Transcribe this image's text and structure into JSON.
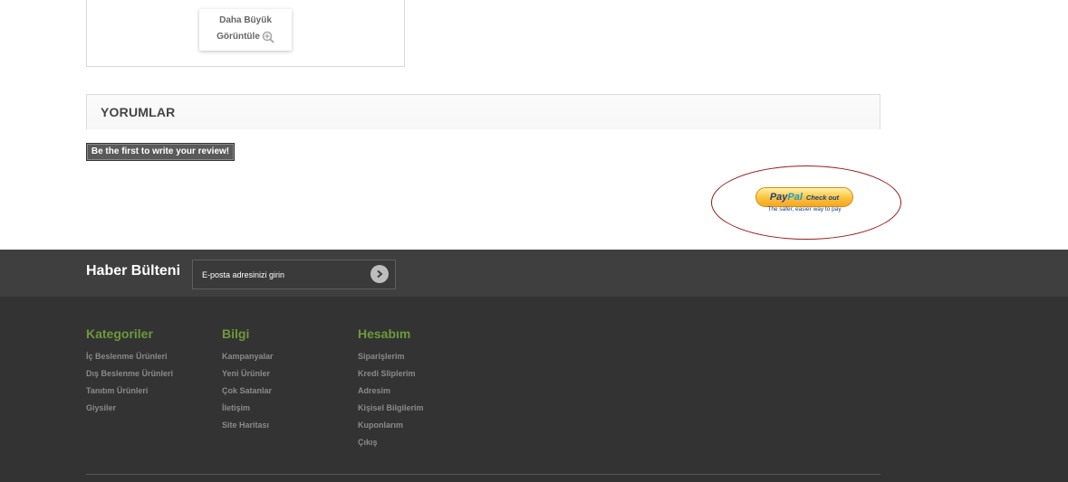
{
  "product_image": {
    "zoom_line1": "Daha Büyük",
    "zoom_line2": "Görüntüle",
    "zoom_icon": "magnifier-plus-icon"
  },
  "comments": {
    "title": "YORUMLAR",
    "review_button": "Be the first to write your review!"
  },
  "paypal": {
    "logo_pay": "Pay",
    "logo_pal": "Pal",
    "checkout": "Check out",
    "tagline": "The safer, easier way to pay"
  },
  "newsletter": {
    "title": "Haber Bülteni",
    "placeholder": "E-posta adresinizi girin",
    "submit_icon": "chevron-right-icon"
  },
  "footer": {
    "columns": [
      {
        "title": "Kategoriler",
        "items": [
          "İç Beslenme Ürünleri",
          "Dış Beslenme Ürünleri",
          "Tanıtım Ürünleri",
          "Giysiler"
        ]
      },
      {
        "title": "Bilgi",
        "items": [
          "Kampanyalar",
          "Yeni Ürünler",
          "Çok Satanlar",
          "İletişim",
          "Site Haritası"
        ]
      },
      {
        "title": "Hesabım",
        "items": [
          "Siparişlerim",
          "Kredi Sliplerim",
          "Adresim",
          "Kişisel Bilgilerim",
          "Kuponlarım",
          "Çıkış"
        ]
      }
    ]
  },
  "colors": {
    "footer_bg": "#333333",
    "newsletter_bg": "#3f3f3f",
    "footer_heading": "#6c9a3a",
    "paypal_annotation": "#9b1b1b"
  }
}
